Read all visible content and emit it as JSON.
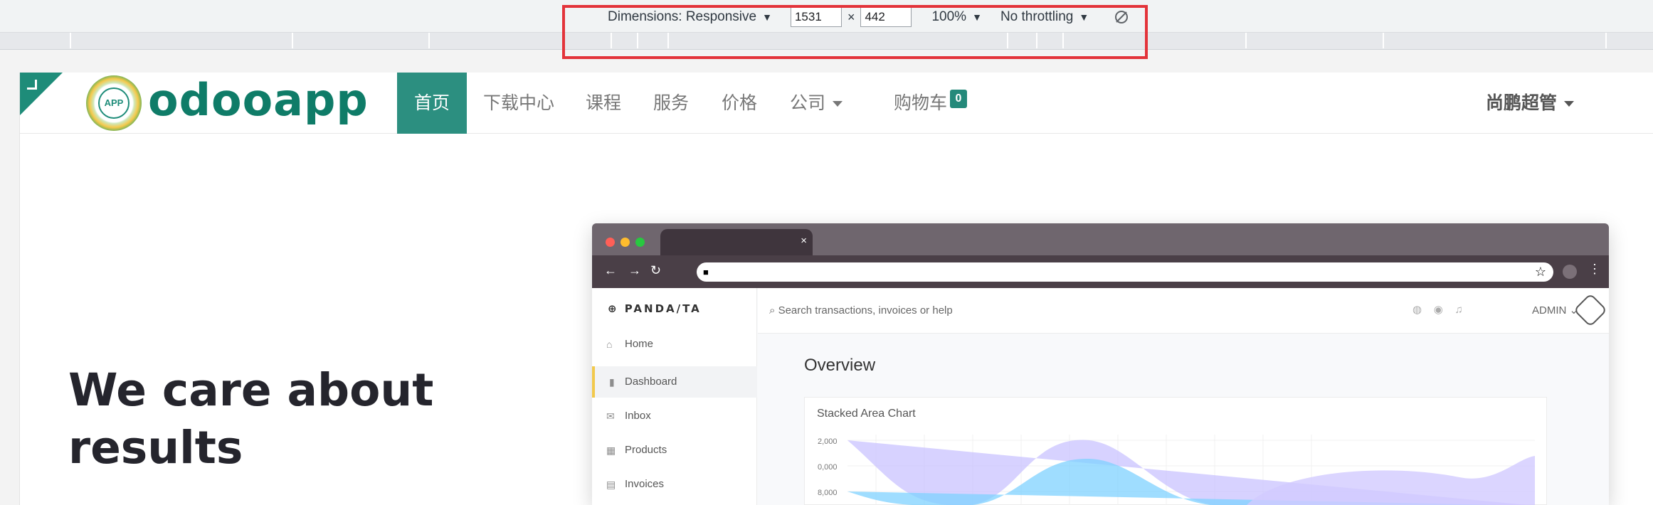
{
  "devtools": {
    "dimensions_label": "Dimensions: Responsive",
    "width": "1531",
    "height": "442",
    "times": "×",
    "zoom": "100%",
    "throttling": "No throttling"
  },
  "site": {
    "logo_badge": "APP",
    "logo_text": "odooapp",
    "nav": [
      "首页",
      "下载中心",
      "课程",
      "服务",
      "价格",
      "公司",
      "购物车"
    ],
    "cart_count": "0",
    "user": "尚鹏超管",
    "hero": [
      "We care about",
      "results"
    ]
  },
  "embedded": {
    "tab_close": "×",
    "brand": "PANDA/TA",
    "sidebar": [
      "Home",
      "Dashboard",
      "Inbox",
      "Products",
      "Invoices"
    ],
    "search_placeholder": "Search transactions, invoices or help",
    "admin": "ADMIN",
    "overview": "Overview",
    "chart_title": "Stacked Area Chart",
    "y_ticks": [
      "2,000",
      "0,000",
      "8,000"
    ]
  },
  "colors": {
    "accent": "#2c8f80",
    "highlight": "#e3333a"
  }
}
